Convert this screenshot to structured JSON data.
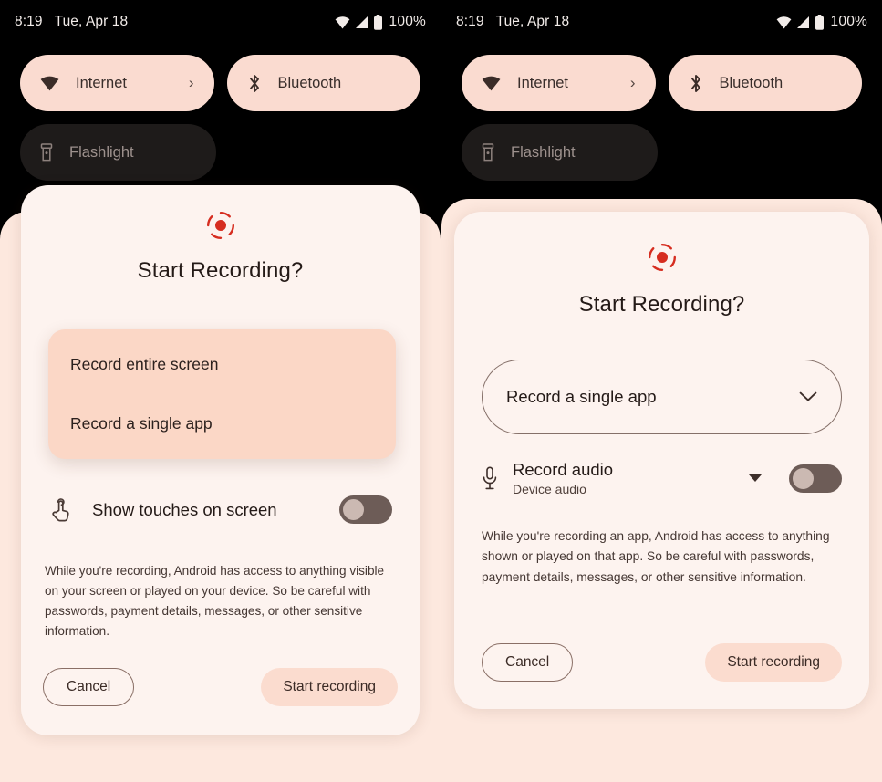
{
  "statusbar": {
    "time": "8:19",
    "date": "Tue, Apr 18",
    "battery_percent": "100%",
    "icons": [
      "wifi-icon",
      "cellular-signal-icon",
      "battery-icon"
    ]
  },
  "quick_settings": {
    "tiles": [
      {
        "label": "Internet",
        "icon": "wifi-icon",
        "chevron": "›",
        "state": "on"
      },
      {
        "label": "Bluetooth",
        "icon": "bluetooth-icon",
        "state": "on"
      },
      {
        "label": "Flashlight",
        "icon": "flashlight-icon",
        "state": "off"
      }
    ]
  },
  "colors": {
    "tile_on_bg": "#fadbd0",
    "tile_off_bg": "#1e1b1a",
    "dialog_bg": "#fdf3ef",
    "scrim_bg": "#fde8de",
    "dropdown_bg": "#fbd7c6",
    "record_red": "#d62d20",
    "toggle_track": "#6d5c57",
    "toggle_knob": "#cbb9b2",
    "start_button_bg": "#fbdccf",
    "text_primary": "#241a17"
  },
  "left_panel": {
    "dialog": {
      "icon": "screen-record-icon",
      "title": "Start Recording?",
      "dropdown_open": true,
      "dropdown_options": [
        "Record entire screen",
        "Record a single app"
      ],
      "show_touches": {
        "icon": "touch-gesture-icon",
        "label": "Show touches on screen",
        "toggle_state": "off"
      },
      "legal_text": "While you're recording, Android has access to anything visible on your screen or played on your device. So be careful with passwords, payment details, messages, or other sensitive information.",
      "cancel_label": "Cancel",
      "start_label": "Start recording"
    }
  },
  "right_panel": {
    "dialog": {
      "icon": "screen-record-icon",
      "title": "Start Recording?",
      "select_value": "Record a single app",
      "select_chevron": "chevron-down-icon",
      "record_audio": {
        "icon": "microphone-icon",
        "title": "Record audio",
        "subtitle": "Device audio",
        "caret": "caret-down-icon",
        "toggle_state": "off"
      },
      "legal_text": "While you're recording an app, Android has access to anything shown or played on that app. So be careful with passwords, payment details, messages, or other sensitive information.",
      "cancel_label": "Cancel",
      "start_label": "Start recording"
    }
  }
}
